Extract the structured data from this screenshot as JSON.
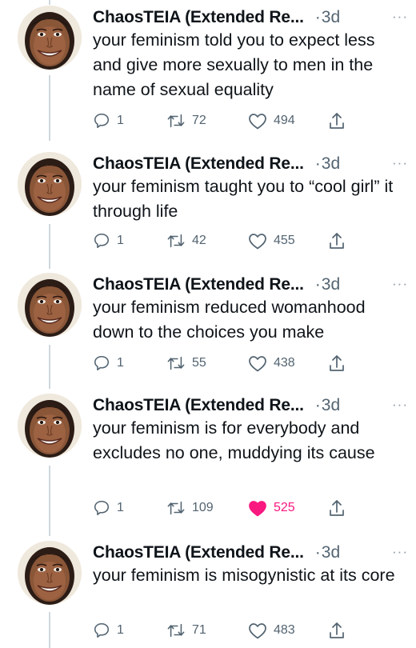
{
  "colors": {
    "text": "#0f1419",
    "muted": "#536471",
    "thread_line": "#cfd9de",
    "like_active": "#f91880"
  },
  "icons": {
    "reply": "reply-icon",
    "retweet": "retweet-icon",
    "like": "heart-icon",
    "share": "share-icon",
    "more": "more-icon"
  },
  "tweets": [
    {
      "author": "ChaosTEIA (Extended Re...",
      "time": "3d",
      "more": "···",
      "text": "your feminism told you to expect less and give more sexually to men in the name of sexual equality",
      "replies": "1",
      "retweets": "72",
      "likes": "494",
      "liked": false
    },
    {
      "author": "ChaosTEIA (Extended Re...",
      "time": "3d",
      "more": "···",
      "text": "your feminism taught you to “cool girl” it through life",
      "replies": "1",
      "retweets": "42",
      "likes": "455",
      "liked": false
    },
    {
      "author": "ChaosTEIA (Extended Re...",
      "time": "3d",
      "more": "···",
      "text": "your feminism reduced womanhood down to the choices you make",
      "replies": "1",
      "retweets": "55",
      "likes": "438",
      "liked": false
    },
    {
      "author": "ChaosTEIA (Extended Re...",
      "time": "3d",
      "more": "···",
      "text": "your feminism is for everybody and excludes no one, muddying its cause",
      "replies": "1",
      "retweets": "109",
      "likes": "525",
      "liked": true
    },
    {
      "author": "ChaosTEIA (Extended Re...",
      "time": "3d",
      "more": "···",
      "text": "your feminism is misogynistic at its core",
      "replies": "1",
      "retweets": "71",
      "likes": "483",
      "liked": false
    }
  ]
}
